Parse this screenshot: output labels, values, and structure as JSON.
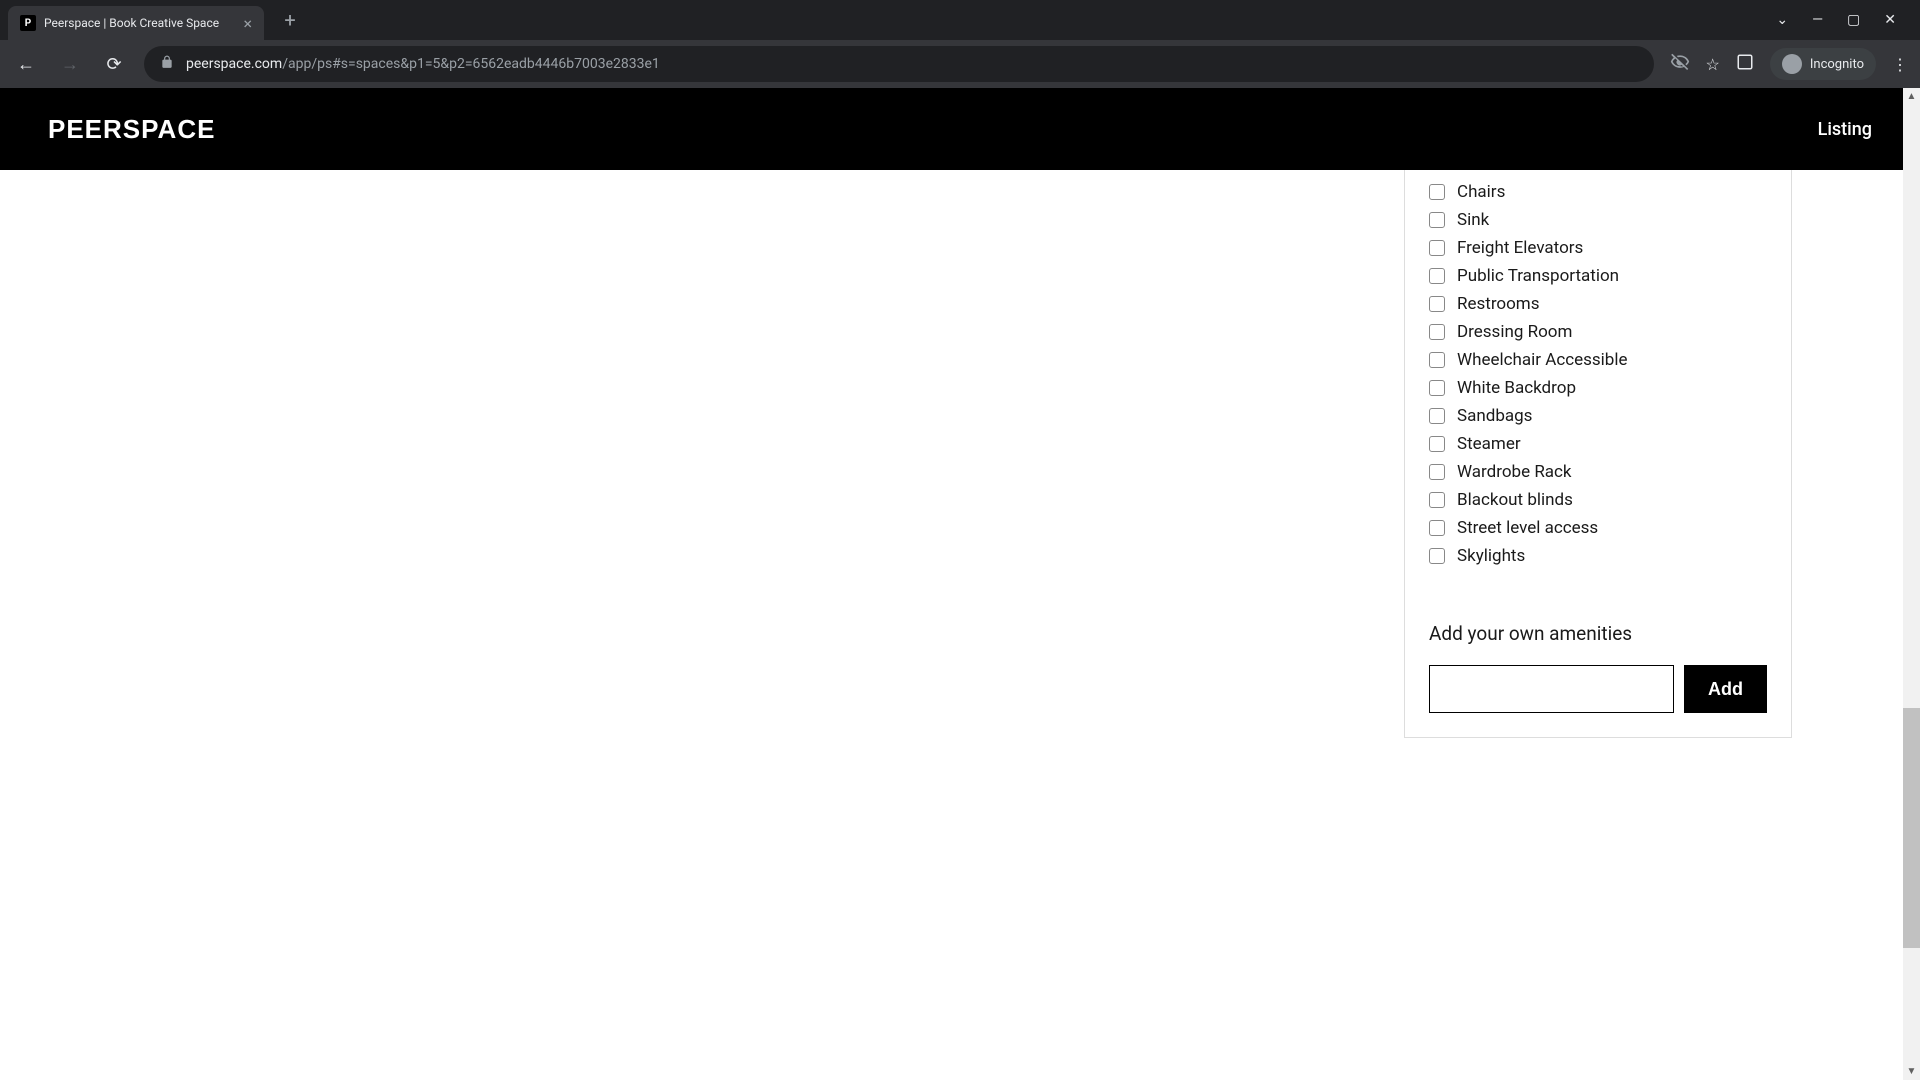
{
  "browser": {
    "tab_title": "Peerspace | Book Creative Space",
    "tab_favicon_letter": "P",
    "url_domain": "peerspace.com",
    "url_path": "/app/ps#s=spaces&p1=5&p2=6562eadb4446b7003e2833e1",
    "incognito_label": "Incognito"
  },
  "header": {
    "logo": "PEERSPACE",
    "nav_link": "Listing"
  },
  "amenities": [
    "Chairs",
    "Sink",
    "Freight Elevators",
    "Public Transportation",
    "Restrooms",
    "Dressing Room",
    "Wheelchair Accessible",
    "White Backdrop",
    "Sandbags",
    "Steamer",
    "Wardrobe Rack",
    "Blackout blinds",
    "Street level access",
    "Skylights"
  ],
  "add_section": {
    "title": "Add your own amenities",
    "button_label": "Add",
    "input_value": ""
  }
}
